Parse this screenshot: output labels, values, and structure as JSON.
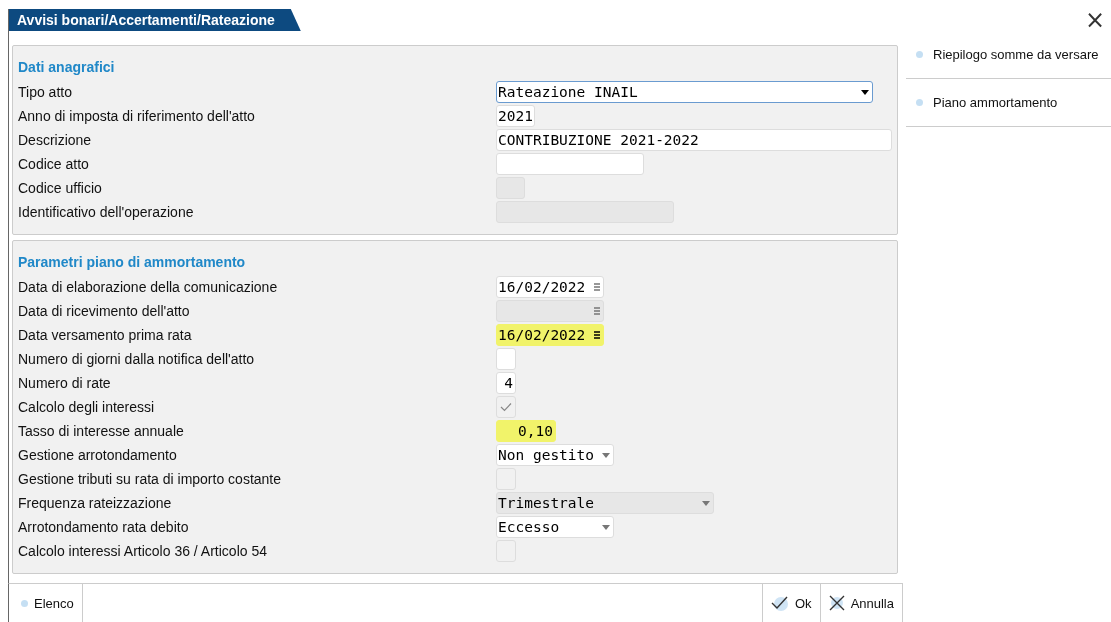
{
  "window": {
    "title": "Avvisi bonari/Accertamenti/Rateazione",
    "close": "×"
  },
  "sections": [
    {
      "title": "Dati anagrafici",
      "fields": [
        {
          "label": "Tipo atto",
          "kind": "select",
          "value": "Rateazione INAIL",
          "focused": true,
          "disabled": false,
          "highlighted": false
        },
        {
          "label": "Anno di imposta di riferimento dell'atto",
          "kind": "text",
          "value": "2021",
          "focused": false,
          "disabled": false,
          "highlighted": false
        },
        {
          "label": "Descrizione",
          "kind": "text",
          "value": "CONTRIBUZIONE 2021-2022",
          "focused": false,
          "disabled": false,
          "highlighted": false
        },
        {
          "label": "Codice atto",
          "kind": "text",
          "focused": false,
          "disabled": false,
          "highlighted": false
        },
        {
          "label": "Codice ufficio",
          "kind": "text",
          "focused": false,
          "disabled": true,
          "highlighted": false
        },
        {
          "label": "Identificativo dell'operazione",
          "kind": "text",
          "focused": false,
          "disabled": true,
          "highlighted": false
        }
      ]
    },
    {
      "title": "Parametri piano di ammortamento",
      "fields": [
        {
          "label": "Data di elaborazione della comunicazione",
          "kind": "date",
          "value": "16/02/2022",
          "focused": false,
          "disabled": false,
          "highlighted": false
        },
        {
          "label": "Data di ricevimento dell'atto",
          "kind": "date",
          "focused": false,
          "disabled": true,
          "highlighted": false
        },
        {
          "label": "Data versamento prima rata",
          "kind": "date",
          "value": "16/02/2022",
          "focused": false,
          "disabled": false,
          "highlighted": true
        },
        {
          "label": "Numero di giorni dalla notifica dell'atto",
          "kind": "number",
          "focused": false,
          "disabled": false,
          "highlighted": false
        },
        {
          "label": "Numero di rate",
          "kind": "number",
          "value": "4",
          "focused": false,
          "disabled": false,
          "highlighted": false
        },
        {
          "label": "Calcolo degli interessi",
          "kind": "check",
          "checked": true
        },
        {
          "label": "Tasso di interesse annuale",
          "kind": "number",
          "value": "0,10",
          "focused": false,
          "disabled": false,
          "highlighted": true
        },
        {
          "label": "Gestione arrotondamento",
          "kind": "select",
          "value": "Non gestito",
          "focused": false,
          "disabled": false,
          "highlighted": false
        },
        {
          "label": "Gestione tributi su rata di importo costante",
          "kind": "check",
          "checked": false
        },
        {
          "label": "Frequenza rateizzazione",
          "kind": "select",
          "value": "Trimestrale",
          "focused": false,
          "disabled": true,
          "highlighted": false
        },
        {
          "label": "Arrotondamento rata debito",
          "kind": "select",
          "value": "Eccesso",
          "focused": false,
          "disabled": false,
          "highlighted": false
        },
        {
          "label": "Calcolo interessi Articolo 36 / Articolo 54",
          "kind": "check",
          "checked": false
        }
      ]
    }
  ],
  "sidebar": {
    "items": [
      {
        "label": "Riepilogo somme da versare"
      },
      {
        "label": "Piano ammortamento"
      }
    ]
  },
  "footer": {
    "left": [
      {
        "label": "Elenco",
        "kind": "dot"
      }
    ],
    "right": [
      {
        "label": "Ok",
        "kind": "check"
      },
      {
        "label": "Annulla",
        "kind": "cross"
      }
    ]
  }
}
